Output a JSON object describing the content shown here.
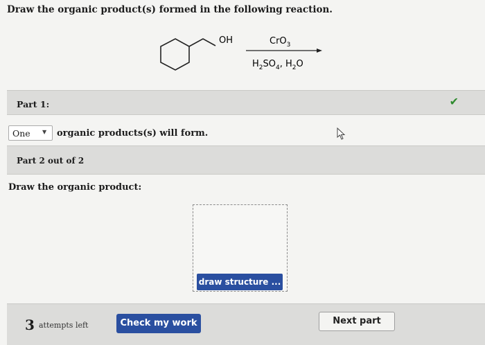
{
  "question": {
    "text": "Draw the organic product(s) formed in the following reaction."
  },
  "reaction": {
    "reactant_label": "OH",
    "reagent_top": {
      "main": "CrO",
      "sub": "3"
    },
    "reagent_bottom": {
      "h": "H",
      "sub1": "2",
      "so": "SO",
      "sub2": "4",
      "comma": ",",
      "h2": " H",
      "sub3": "2",
      "o": "O"
    }
  },
  "part1": {
    "label": "Part 1:",
    "status_icon": "check-mark-icon",
    "status_color": "#2e8b2e",
    "select_value": "One",
    "select_text": "organic products(s) will form."
  },
  "part2": {
    "label": "Part 2 out of 2",
    "instruction": "Draw the organic product:",
    "draw_button": "draw structure ..."
  },
  "footer": {
    "attempts_count": "3",
    "attempts_label": "attempts left",
    "check_button": "Check my work",
    "next_button": "Next part"
  },
  "colors": {
    "primary_button": "#2a4fa0",
    "bar_bg": "#dcdcda",
    "page_bg": "#f4f4f2"
  }
}
